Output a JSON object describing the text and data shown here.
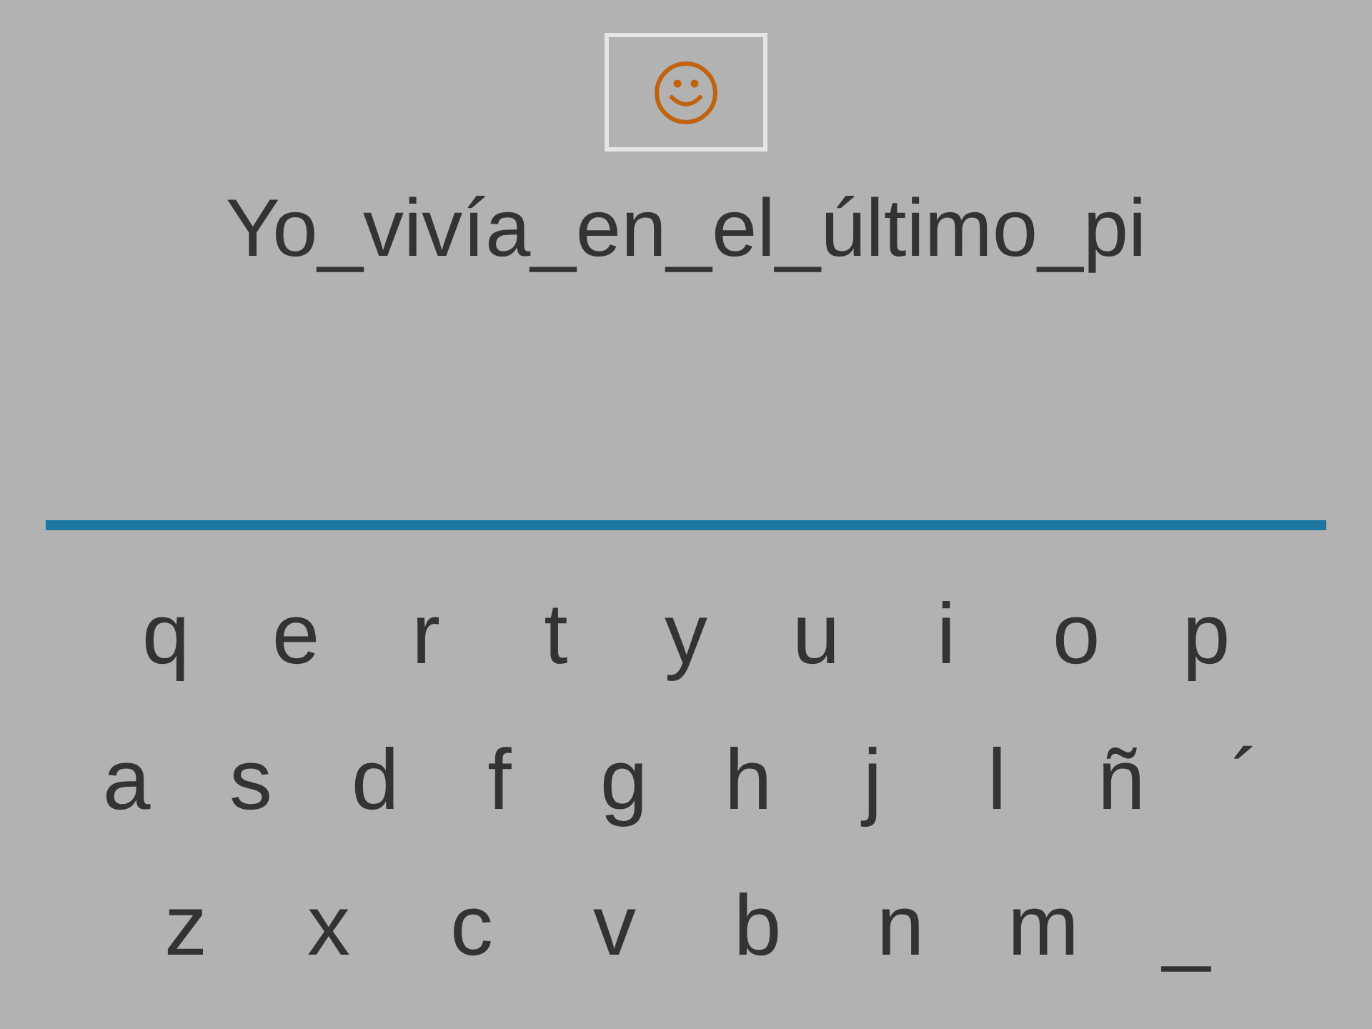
{
  "sentence": "Yo_vivía_en_el_último_pi",
  "keyboard_rows": [
    [
      "q",
      "e",
      "r",
      "t",
      "y",
      "u",
      "i",
      "o",
      "p"
    ],
    [
      "a",
      "s",
      "d",
      "f",
      "g",
      "h",
      "j",
      "l",
      "ñ",
      "´"
    ],
    [
      "z",
      "x",
      "c",
      "v",
      "b",
      "n",
      "m",
      "_"
    ]
  ]
}
